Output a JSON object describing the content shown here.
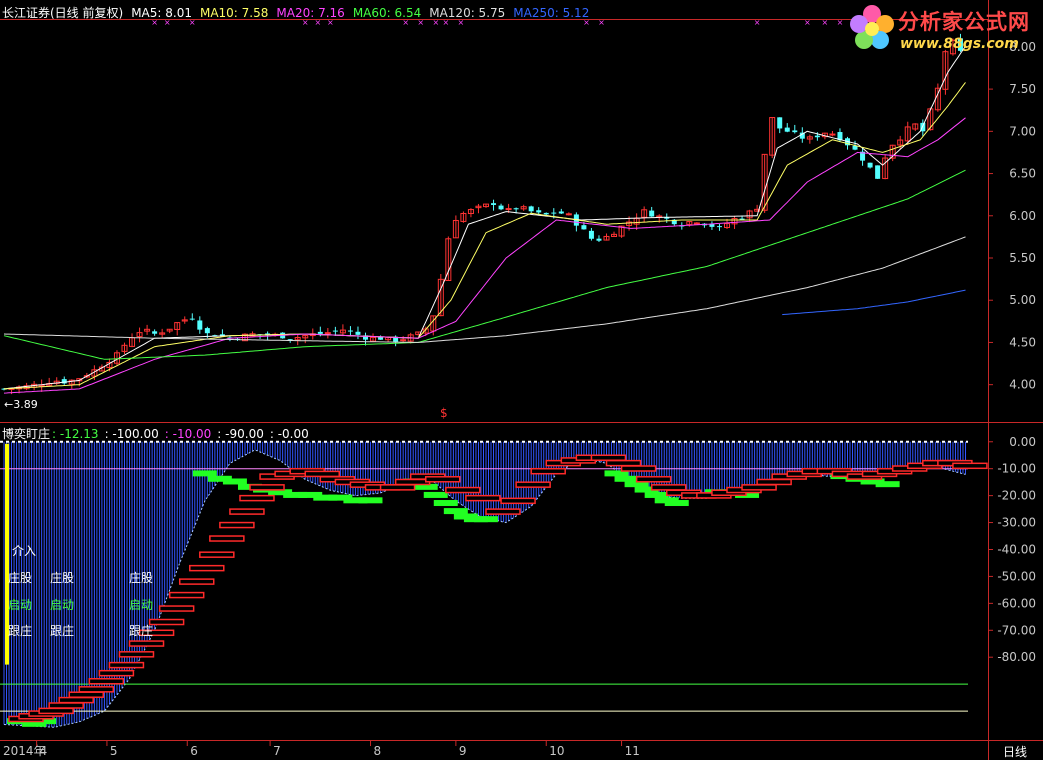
{
  "window": {
    "stock_name": "长江证券(日线 前复权)",
    "period_label": "日线"
  },
  "price_header": [
    {
      "label": "MA5",
      "value": "8.01",
      "color": "#ffffff"
    },
    {
      "label": "MA10",
      "value": "7.58",
      "color": "#ffff66"
    },
    {
      "label": "MA20",
      "value": "7.16",
      "color": "#ff44ff"
    },
    {
      "label": "MA60",
      "value": "6.54",
      "color": "#44ff44"
    },
    {
      "label": "MA120",
      "value": "5.75",
      "color": "#dddddd"
    },
    {
      "label": "MA250",
      "value": "5.12",
      "color": "#3366ff"
    }
  ],
  "indicator_header": {
    "name": "博奕盯庄",
    "items": [
      {
        "text": ": -12.13",
        "color": "#44ff44"
      },
      {
        "text": ": -100.00",
        "color": "#ffffff"
      },
      {
        "text": ": -10.00",
        "color": "#ff44ff"
      },
      {
        "text": ": -90.00",
        "color": "#ffffff"
      },
      {
        "text": ": -0.00",
        "color": "#ffffff"
      }
    ]
  },
  "low_marker": "←3.89",
  "signal_marker": "$",
  "legend_labels": {
    "jieru": "介入",
    "zhuanggu": "庄股",
    "qidong": "启动",
    "genzhuang": "跟庄"
  },
  "logo": {
    "title": "分析家公式网",
    "url": "www.88gs.com"
  },
  "chart_data": [
    {
      "type": "candlestick",
      "title": "",
      "ylim": [
        3.7,
        8.2
      ],
      "y_ticks": [
        "8.00",
        "7.50",
        "7.00",
        "6.50",
        "6.00",
        "5.50",
        "5.00",
        "4.50",
        "4.00"
      ],
      "y_tick_values": [
        8.0,
        7.5,
        7.0,
        6.5,
        6.0,
        5.5,
        5.0,
        4.5,
        4.0
      ],
      "x_labels": [
        "2014年",
        "4",
        "5",
        "6",
        "7",
        "8",
        "9",
        "10",
        "11"
      ],
      "series": [
        {
          "name": "MA5",
          "color": "#ffffff"
        },
        {
          "name": "MA10",
          "color": "#ffff66"
        },
        {
          "name": "MA20",
          "color": "#ff44ff"
        },
        {
          "name": "MA60",
          "color": "#44ff44"
        },
        {
          "name": "MA120",
          "color": "#dddddd"
        },
        {
          "name": "MA250",
          "color": "#3366ff"
        }
      ],
      "price_path": [
        [
          0,
          3.95
        ],
        [
          10,
          3.98
        ],
        [
          20,
          4.05
        ],
        [
          25,
          4.03
        ],
        [
          30,
          4.08
        ],
        [
          35,
          4.15
        ],
        [
          40,
          4.25
        ],
        [
          45,
          4.35
        ],
        [
          50,
          4.55
        ],
        [
          55,
          4.65
        ],
        [
          60,
          4.6
        ],
        [
          65,
          4.65
        ],
        [
          70,
          4.75
        ],
        [
          75,
          4.8
        ],
        [
          80,
          4.6
        ],
        [
          85,
          4.6
        ],
        [
          90,
          4.55
        ],
        [
          100,
          4.6
        ],
        [
          110,
          4.58
        ],
        [
          115,
          4.55
        ],
        [
          120,
          4.58
        ],
        [
          130,
          4.62
        ],
        [
          135,
          4.65
        ],
        [
          140,
          4.6
        ],
        [
          145,
          4.55
        ],
        [
          150,
          4.55
        ],
        [
          155,
          4.52
        ],
        [
          160,
          4.55
        ],
        [
          165,
          4.6
        ],
        [
          170,
          4.7
        ],
        [
          172,
          4.95
        ],
        [
          175,
          5.4
        ],
        [
          178,
          5.9
        ],
        [
          181,
          6.0
        ],
        [
          185,
          6.05
        ],
        [
          190,
          6.1
        ],
        [
          195,
          6.15
        ],
        [
          200,
          6.05
        ],
        [
          205,
          6.1
        ],
        [
          210,
          6.05
        ],
        [
          215,
          6.0
        ],
        [
          220,
          6.05
        ],
        [
          225,
          6.0
        ],
        [
          230,
          5.85
        ],
        [
          235,
          5.7
        ],
        [
          240,
          5.75
        ],
        [
          245,
          5.85
        ],
        [
          250,
          5.95
        ],
        [
          255,
          6.05
        ],
        [
          260,
          6.0
        ],
        [
          265,
          5.95
        ],
        [
          270,
          5.9
        ],
        [
          275,
          5.95
        ],
        [
          280,
          5.9
        ],
        [
          285,
          5.85
        ],
        [
          290,
          5.95
        ],
        [
          295,
          6.0
        ],
        [
          300,
          6.1
        ],
        [
          302,
          6.5
        ],
        [
          305,
          7.2
        ],
        [
          308,
          7.05
        ],
        [
          312,
          7.0
        ],
        [
          316,
          6.95
        ],
        [
          320,
          6.9
        ],
        [
          324,
          6.95
        ],
        [
          328,
          7.0
        ],
        [
          332,
          6.95
        ],
        [
          336,
          6.85
        ],
        [
          340,
          6.75
        ],
        [
          344,
          6.6
        ],
        [
          348,
          6.45
        ],
        [
          350,
          6.65
        ],
        [
          354,
          6.85
        ],
        [
          358,
          6.95
        ],
        [
          362,
          7.1
        ],
        [
          366,
          7.0
        ],
        [
          368,
          7.15
        ],
        [
          372,
          7.5
        ],
        [
          374,
          7.8
        ],
        [
          376,
          8.1
        ],
        [
          380,
          8.0
        ],
        [
          383,
          7.8
        ]
      ],
      "ma_paths": {
        "MA5": [
          [
            0,
            3.95
          ],
          [
            30,
            4.05
          ],
          [
            60,
            4.55
          ],
          [
            90,
            4.58
          ],
          [
            120,
            4.6
          ],
          [
            165,
            4.55
          ],
          [
            175,
            5.2
          ],
          [
            185,
            5.9
          ],
          [
            200,
            6.05
          ],
          [
            230,
            5.95
          ],
          [
            260,
            5.98
          ],
          [
            300,
            6.0
          ],
          [
            308,
            6.8
          ],
          [
            320,
            7.0
          ],
          [
            340,
            6.85
          ],
          [
            350,
            6.6
          ],
          [
            365,
            7.0
          ],
          [
            376,
            7.7
          ],
          [
            383,
            8.01
          ]
        ],
        "MA10": [
          [
            0,
            3.95
          ],
          [
            30,
            4.0
          ],
          [
            60,
            4.45
          ],
          [
            90,
            4.58
          ],
          [
            120,
            4.6
          ],
          [
            165,
            4.55
          ],
          [
            178,
            5.0
          ],
          [
            192,
            5.8
          ],
          [
            210,
            6.03
          ],
          [
            240,
            5.9
          ],
          [
            270,
            5.95
          ],
          [
            300,
            5.95
          ],
          [
            312,
            6.6
          ],
          [
            330,
            6.9
          ],
          [
            350,
            6.75
          ],
          [
            365,
            6.9
          ],
          [
            376,
            7.3
          ],
          [
            383,
            7.58
          ]
        ],
        "MA20": [
          [
            0,
            3.9
          ],
          [
            30,
            3.95
          ],
          [
            60,
            4.3
          ],
          [
            90,
            4.55
          ],
          [
            120,
            4.6
          ],
          [
            165,
            4.55
          ],
          [
            180,
            4.75
          ],
          [
            200,
            5.5
          ],
          [
            220,
            5.95
          ],
          [
            250,
            5.85
          ],
          [
            280,
            5.9
          ],
          [
            305,
            5.95
          ],
          [
            320,
            6.4
          ],
          [
            340,
            6.75
          ],
          [
            360,
            6.7
          ],
          [
            372,
            6.9
          ],
          [
            383,
            7.16
          ]
        ],
        "MA60": [
          [
            0,
            4.58
          ],
          [
            40,
            4.3
          ],
          [
            80,
            4.35
          ],
          [
            120,
            4.45
          ],
          [
            165,
            4.5
          ],
          [
            200,
            4.8
          ],
          [
            240,
            5.15
          ],
          [
            280,
            5.4
          ],
          [
            310,
            5.7
          ],
          [
            340,
            6.0
          ],
          [
            360,
            6.2
          ],
          [
            383,
            6.54
          ]
        ],
        "MA120": [
          [
            0,
            4.6
          ],
          [
            60,
            4.55
          ],
          [
            120,
            4.52
          ],
          [
            165,
            4.5
          ],
          [
            200,
            4.58
          ],
          [
            240,
            4.72
          ],
          [
            280,
            4.9
          ],
          [
            320,
            5.15
          ],
          [
            350,
            5.38
          ],
          [
            383,
            5.75
          ]
        ],
        "MA250": [
          [
            310,
            4.83
          ],
          [
            340,
            4.9
          ],
          [
            360,
            4.98
          ],
          [
            383,
            5.12
          ]
        ]
      }
    },
    {
      "type": "area",
      "title": "博奕盯庄",
      "ylim": [
        -110,
        4
      ],
      "y_ticks": [
        "0.00",
        "-10.00",
        "-20.00",
        "-30.00",
        "-40.00",
        "-50.00",
        "-60.00",
        "-70.00",
        "-80.00"
      ],
      "y_tick_values": [
        0,
        -10,
        -20,
        -30,
        -40,
        -50,
        -60,
        -70,
        -80
      ],
      "reference_lines": [
        {
          "value": 0,
          "color": "#ffffff",
          "dotted": true
        },
        {
          "value": -10,
          "color": "#ff88ff"
        },
        {
          "value": -90,
          "color": "#44ff44"
        },
        {
          "value": -100,
          "color": "#ffffcc"
        }
      ],
      "series": [
        {
          "name": "曲线",
          "color": "#3355ff"
        }
      ],
      "curve": [
        [
          0,
          -105
        ],
        [
          20,
          -106
        ],
        [
          30,
          -104
        ],
        [
          40,
          -100
        ],
        [
          50,
          -88
        ],
        [
          60,
          -70
        ],
        [
          70,
          -45
        ],
        [
          80,
          -22
        ],
        [
          90,
          -8
        ],
        [
          100,
          -3
        ],
        [
          110,
          -7
        ],
        [
          120,
          -14
        ],
        [
          130,
          -18
        ],
        [
          140,
          -20
        ],
        [
          150,
          -19
        ],
        [
          160,
          -15
        ],
        [
          170,
          -14
        ],
        [
          180,
          -22
        ],
        [
          190,
          -28
        ],
        [
          200,
          -30
        ],
        [
          210,
          -24
        ],
        [
          220,
          -12
        ],
        [
          230,
          -6
        ],
        [
          240,
          -8
        ],
        [
          250,
          -15
        ],
        [
          260,
          -20
        ],
        [
          270,
          -21
        ],
        [
          280,
          -21
        ],
        [
          290,
          -19
        ],
        [
          300,
          -17
        ],
        [
          310,
          -14
        ],
        [
          320,
          -12
        ],
        [
          330,
          -13
        ],
        [
          340,
          -13
        ],
        [
          350,
          -12
        ],
        [
          360,
          -10
        ],
        [
          370,
          -9
        ],
        [
          383,
          -12.13
        ]
      ],
      "red_ladder": [
        [
          2,
          -102
        ],
        [
          6,
          -101
        ],
        [
          10,
          -100
        ],
        [
          14,
          -99
        ],
        [
          18,
          -97
        ],
        [
          22,
          -95
        ],
        [
          26,
          -93
        ],
        [
          30,
          -91
        ],
        [
          34,
          -88
        ],
        [
          38,
          -85
        ],
        [
          42,
          -82
        ],
        [
          46,
          -78
        ],
        [
          50,
          -74
        ],
        [
          54,
          -70
        ],
        [
          58,
          -66
        ],
        [
          62,
          -61
        ],
        [
          66,
          -56
        ],
        [
          70,
          -51
        ],
        [
          74,
          -46
        ],
        [
          78,
          -41
        ],
        [
          82,
          -35
        ],
        [
          86,
          -30
        ],
        [
          90,
          -25
        ],
        [
          94,
          -20
        ],
        [
          98,
          -16
        ],
        [
          102,
          -12
        ],
        [
          108,
          -11
        ],
        [
          114,
          -10
        ],
        [
          120,
          -11
        ],
        [
          126,
          -13
        ],
        [
          132,
          -14
        ],
        [
          138,
          -15
        ],
        [
          144,
          -16
        ],
        [
          150,
          -16
        ],
        [
          156,
          -14
        ],
        [
          162,
          -12
        ],
        [
          168,
          -13
        ],
        [
          176,
          -17
        ],
        [
          184,
          -20
        ],
        [
          192,
          -25
        ],
        [
          198,
          -21
        ],
        [
          204,
          -15
        ],
        [
          210,
          -10
        ],
        [
          216,
          -7
        ],
        [
          222,
          -6
        ],
        [
          228,
          -5
        ],
        [
          234,
          -5
        ],
        [
          240,
          -7
        ],
        [
          246,
          -9
        ],
        [
          252,
          -13
        ],
        [
          258,
          -16
        ],
        [
          264,
          -18
        ],
        [
          270,
          -19
        ],
        [
          276,
          -19
        ],
        [
          282,
          -18
        ],
        [
          288,
          -17
        ],
        [
          294,
          -16
        ],
        [
          300,
          -14
        ],
        [
          306,
          -12
        ],
        [
          312,
          -11
        ],
        [
          318,
          -10
        ],
        [
          324,
          -10
        ],
        [
          330,
          -11
        ],
        [
          336,
          -12
        ],
        [
          342,
          -11
        ],
        [
          348,
          -10
        ],
        [
          354,
          -9
        ],
        [
          360,
          -8
        ],
        [
          366,
          -7
        ],
        [
          372,
          -7
        ],
        [
          378,
          -8
        ]
      ],
      "green_blocks": [
        [
          2,
          -103
        ],
        [
          8,
          -104
        ],
        [
          12,
          -103
        ],
        [
          76,
          -11
        ],
        [
          82,
          -13
        ],
        [
          88,
          -14
        ],
        [
          94,
          -16
        ],
        [
          100,
          -17
        ],
        [
          106,
          -18
        ],
        [
          112,
          -19
        ],
        [
          118,
          -19
        ],
        [
          124,
          -20
        ],
        [
          130,
          -20
        ],
        [
          136,
          -21
        ],
        [
          142,
          -21
        ],
        [
          160,
          -14
        ],
        [
          164,
          -16
        ],
        [
          168,
          -19
        ],
        [
          172,
          -22
        ],
        [
          176,
          -25
        ],
        [
          180,
          -27
        ],
        [
          184,
          -28
        ],
        [
          188,
          -28
        ],
        [
          240,
          -11
        ],
        [
          244,
          -13
        ],
        [
          248,
          -15
        ],
        [
          252,
          -17
        ],
        [
          256,
          -19
        ],
        [
          260,
          -21
        ],
        [
          264,
          -22
        ],
        [
          280,
          -18
        ],
        [
          286,
          -18
        ],
        [
          292,
          -19
        ],
        [
          330,
          -12
        ],
        [
          336,
          -13
        ],
        [
          342,
          -14
        ],
        [
          348,
          -15
        ]
      ]
    }
  ]
}
